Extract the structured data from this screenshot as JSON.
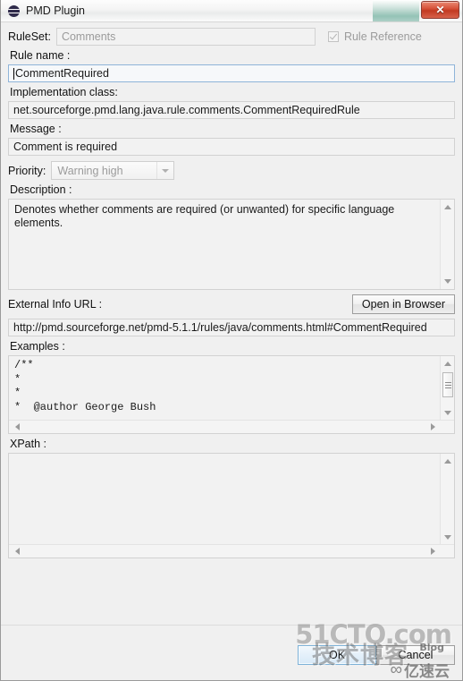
{
  "window": {
    "title": "PMD Plugin",
    "icon": "pmd-logo-icon",
    "close_label": "✕"
  },
  "ruleset": {
    "label": "RuleSet:",
    "value": "Comments",
    "rule_reference_label": "Rule Reference",
    "rule_reference_checked": true
  },
  "rule_name": {
    "label": "Rule name :",
    "value": "CommentRequired"
  },
  "implementation_class": {
    "label": "Implementation class:",
    "value": "net.sourceforge.pmd.lang.java.rule.comments.CommentRequiredRule"
  },
  "message": {
    "label": "Message :",
    "value": "Comment is required"
  },
  "priority": {
    "label": "Priority:",
    "value": "Warning high"
  },
  "description": {
    "label": "Description :",
    "value": "Denotes whether comments are required (or unwanted) for specific language elements."
  },
  "external_info_url": {
    "label": "External Info URL :",
    "button_label": "Open in Browser",
    "value": "http://pmd.sourceforge.net/pmd-5.1.1/rules/java/comments.html#CommentRequired"
  },
  "examples": {
    "label": "Examples :",
    "value": "/**\n*\n*\n*  @author George Bush"
  },
  "xpath": {
    "label": "XPath :",
    "value": ""
  },
  "buttons": {
    "ok": "OK",
    "cancel": "Cancel"
  },
  "watermarks": {
    "site": "51CTO.com",
    "cn_tagline": "技术博客",
    "blog": "Blog",
    "yisu_mark": "∞",
    "yisu": "亿速云"
  },
  "colors": {
    "window_bg": "#f0f0f0",
    "field_bg": "#f2f2f2",
    "field_border": "#d2d2d2",
    "focus_border": "#8fb4d9",
    "close_red": "#c23a22",
    "default_button_blue": "#7db2d8",
    "disabled_text": "#9b9b9b"
  }
}
